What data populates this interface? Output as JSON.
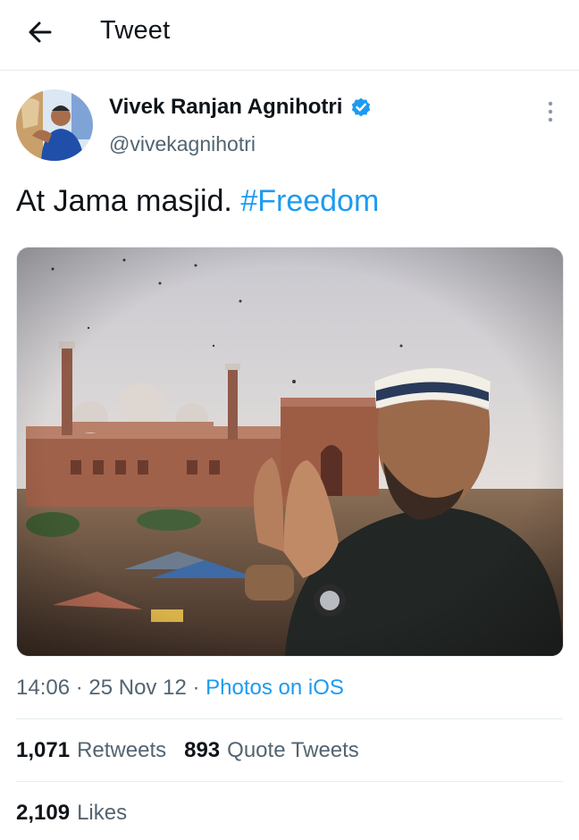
{
  "header": {
    "title": "Tweet"
  },
  "author": {
    "name": "Vivek Ranjan Agnihotri",
    "handle": "@vivekagnihotri",
    "verified": true
  },
  "tweet": {
    "text": "At Jama masjid.",
    "hashtag": "#Freedom"
  },
  "meta": {
    "time": "14:06",
    "sep1": " · ",
    "date": "25 Nov 12",
    "sep2": " · ",
    "source": "Photos on iOS"
  },
  "stats": {
    "retweets_count": "1,071",
    "retweets_label": "Retweets",
    "quotes_count": "893",
    "quotes_label": "Quote Tweets",
    "likes_count": "2,109",
    "likes_label": "Likes"
  },
  "colors": {
    "accent": "#1d9bf0",
    "muted": "#536471",
    "text": "#0f1419",
    "divider": "#e6ecf0"
  },
  "icons": {
    "back": "arrow-left-icon",
    "verified": "verified-badge-icon",
    "more": "more-vertical-icon"
  }
}
